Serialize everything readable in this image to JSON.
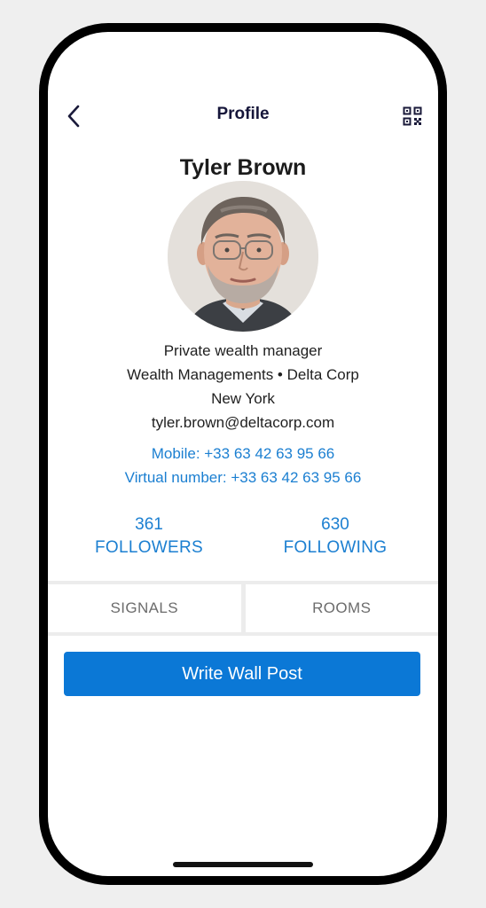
{
  "header": {
    "title": "Profile"
  },
  "profile": {
    "name": "Tyler Brown",
    "job_title": "Private wealth manager",
    "department_company": "Wealth Managements • Delta Corp",
    "location": "New York",
    "email": "tyler.brown@deltacorp.com",
    "mobile": "Mobile: +33 63 42 63 95 66",
    "virtual_number": "Virtual number: +33 63 42 63 95 66"
  },
  "stats": {
    "followers": {
      "count": "361",
      "label": "FOLLOWERS"
    },
    "following": {
      "count": "630",
      "label": "FOLLOWING"
    }
  },
  "tabs": [
    {
      "label": "SIGNALS"
    },
    {
      "label": "ROOMS"
    }
  ],
  "actions": {
    "write_wall_post": "Write Wall Post"
  },
  "colors": {
    "accent": "#0b78d6",
    "link": "#1b7fd1",
    "title": "#16163a"
  }
}
